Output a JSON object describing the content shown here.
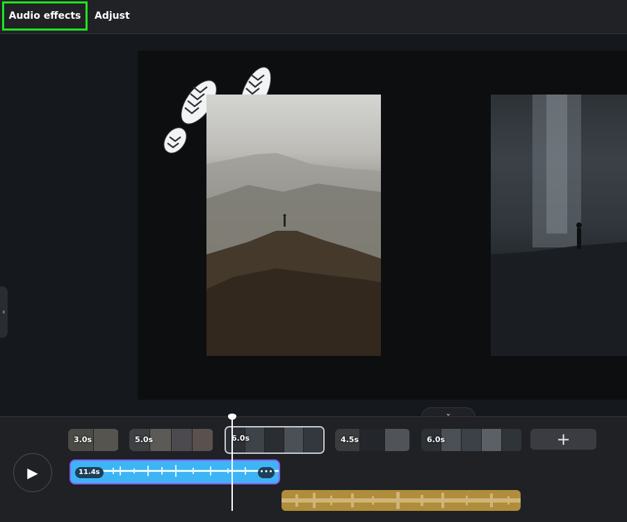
{
  "toolbar": {
    "tab_audio_effects": "Audio effects",
    "tab_adjust": "Adjust"
  },
  "stage": {
    "side_toggle_icon": "‹",
    "collapse_icon": "⌄"
  },
  "timeline": {
    "clips": [
      {
        "duration": "3.0s"
      },
      {
        "duration": "5.0s"
      },
      {
        "duration": "6.0s"
      },
      {
        "duration": "4.5s"
      },
      {
        "duration": "6.0s"
      }
    ],
    "add_label": "+",
    "play_icon": "▶",
    "audio": {
      "duration": "11.4s",
      "more": "•••"
    }
  },
  "colors": {
    "accent_selected_tab": "#22e322",
    "audio_clip": "#3db5f5",
    "audio_border": "#8b5cf6",
    "audio2": "#b08d3a"
  },
  "icons": [
    "play-icon",
    "plus-icon",
    "chevron-left-icon",
    "chevron-down-icon",
    "more-icon"
  ]
}
